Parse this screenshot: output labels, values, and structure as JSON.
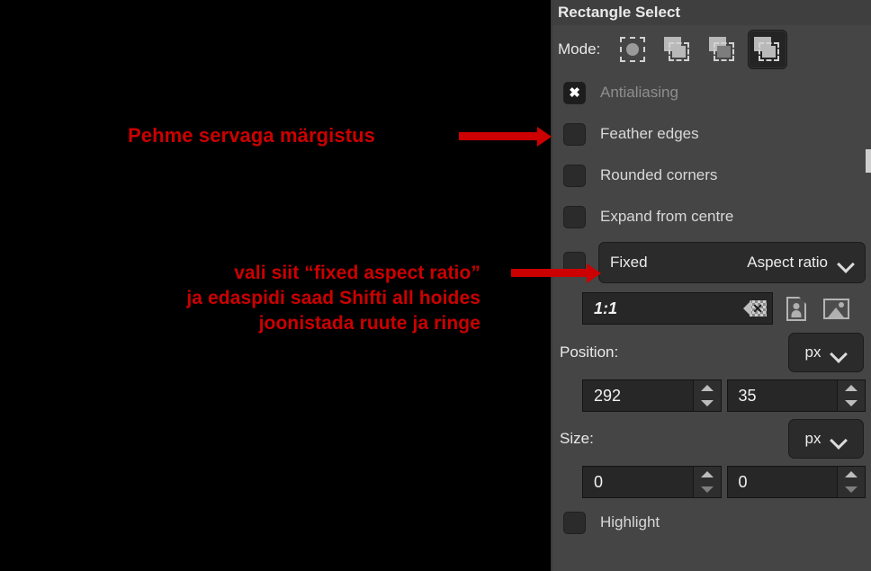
{
  "annotations": {
    "note1": "Pehme servaga märgistus",
    "note2_lines": [
      "vali siit “fixed aspect ratio”",
      "ja edaspidi saad Shifti all hoides",
      "joonistada ruute ja ringe"
    ],
    "arrow1_name": "red-arrow-to-feather-edges",
    "arrow2_name": "red-arrow-to-fixed-dropdown",
    "color": "#cc0000"
  },
  "panel": {
    "title": "Rectangle Select",
    "mode": {
      "label": "Mode:",
      "buttons": [
        {
          "name": "replace-selection",
          "selected": false
        },
        {
          "name": "add-to-selection",
          "selected": false
        },
        {
          "name": "subtract-from-selection",
          "selected": false
        },
        {
          "name": "intersect-with-selection",
          "selected": true
        }
      ]
    },
    "checkboxes": [
      {
        "label": "Antialiasing",
        "checked": true,
        "disabled": true
      },
      {
        "label": "Feather edges",
        "checked": false,
        "disabled": false
      },
      {
        "label": "Rounded corners",
        "checked": false,
        "disabled": false
      },
      {
        "label": "Expand from centre",
        "checked": false,
        "disabled": false
      }
    ],
    "fixed": {
      "checked": false,
      "label": "Fixed",
      "value": "Aspect ratio",
      "chevron": "chevron-down-icon"
    },
    "ratio": {
      "value": "1:1",
      "clear_icon": "clear-entry-icon",
      "portrait_icon": "portrait-orientation-icon",
      "landscape_icon": "landscape-orientation-icon"
    },
    "position": {
      "label": "Position:",
      "unit": "px",
      "x": "292",
      "y": "35"
    },
    "size": {
      "label": "Size:",
      "unit": "px",
      "width": "0",
      "height": "0"
    },
    "highlight": {
      "label": "Highlight",
      "checked": false
    }
  }
}
